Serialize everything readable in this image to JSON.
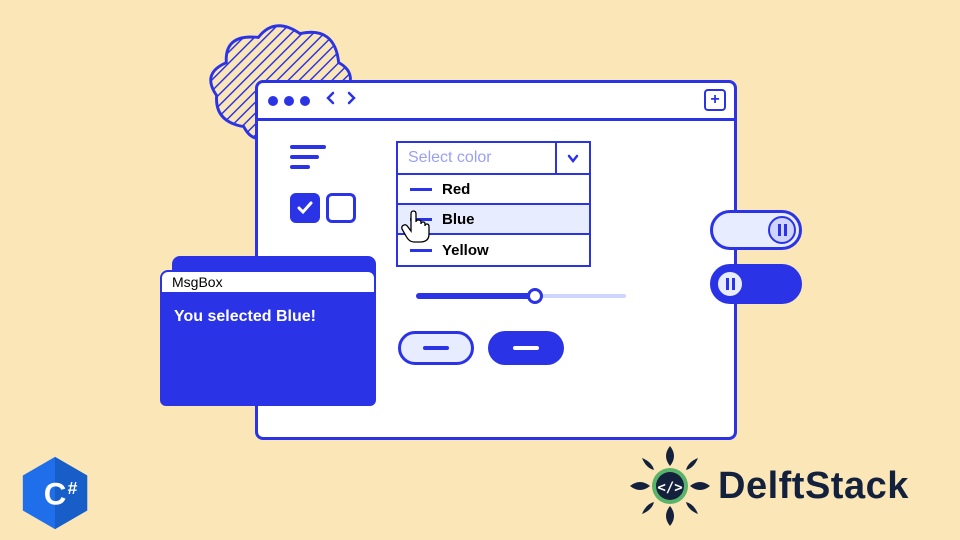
{
  "window": {
    "add_label": "+"
  },
  "select": {
    "placeholder": "Select color",
    "options": [
      {
        "label": "Red"
      },
      {
        "label": "Blue"
      },
      {
        "label": "Yellow"
      }
    ],
    "selected_index": 1
  },
  "msgbox": {
    "title": "MsgBox",
    "message": "You selected Blue!"
  },
  "buttons": {
    "outline": "—",
    "solid": "—"
  },
  "slider": {
    "value": 55,
    "min": 0,
    "max": 100
  },
  "toggles": [
    {
      "state": "off"
    },
    {
      "state": "on"
    }
  ],
  "checkboxes": [
    {
      "checked": true
    },
    {
      "checked": false
    }
  ],
  "badges": {
    "csharp": "C#",
    "brand": "DelftStack"
  },
  "colors": {
    "primary": "#2a33e6",
    "bg": "#fae6b6",
    "light": "#e8ecff"
  }
}
